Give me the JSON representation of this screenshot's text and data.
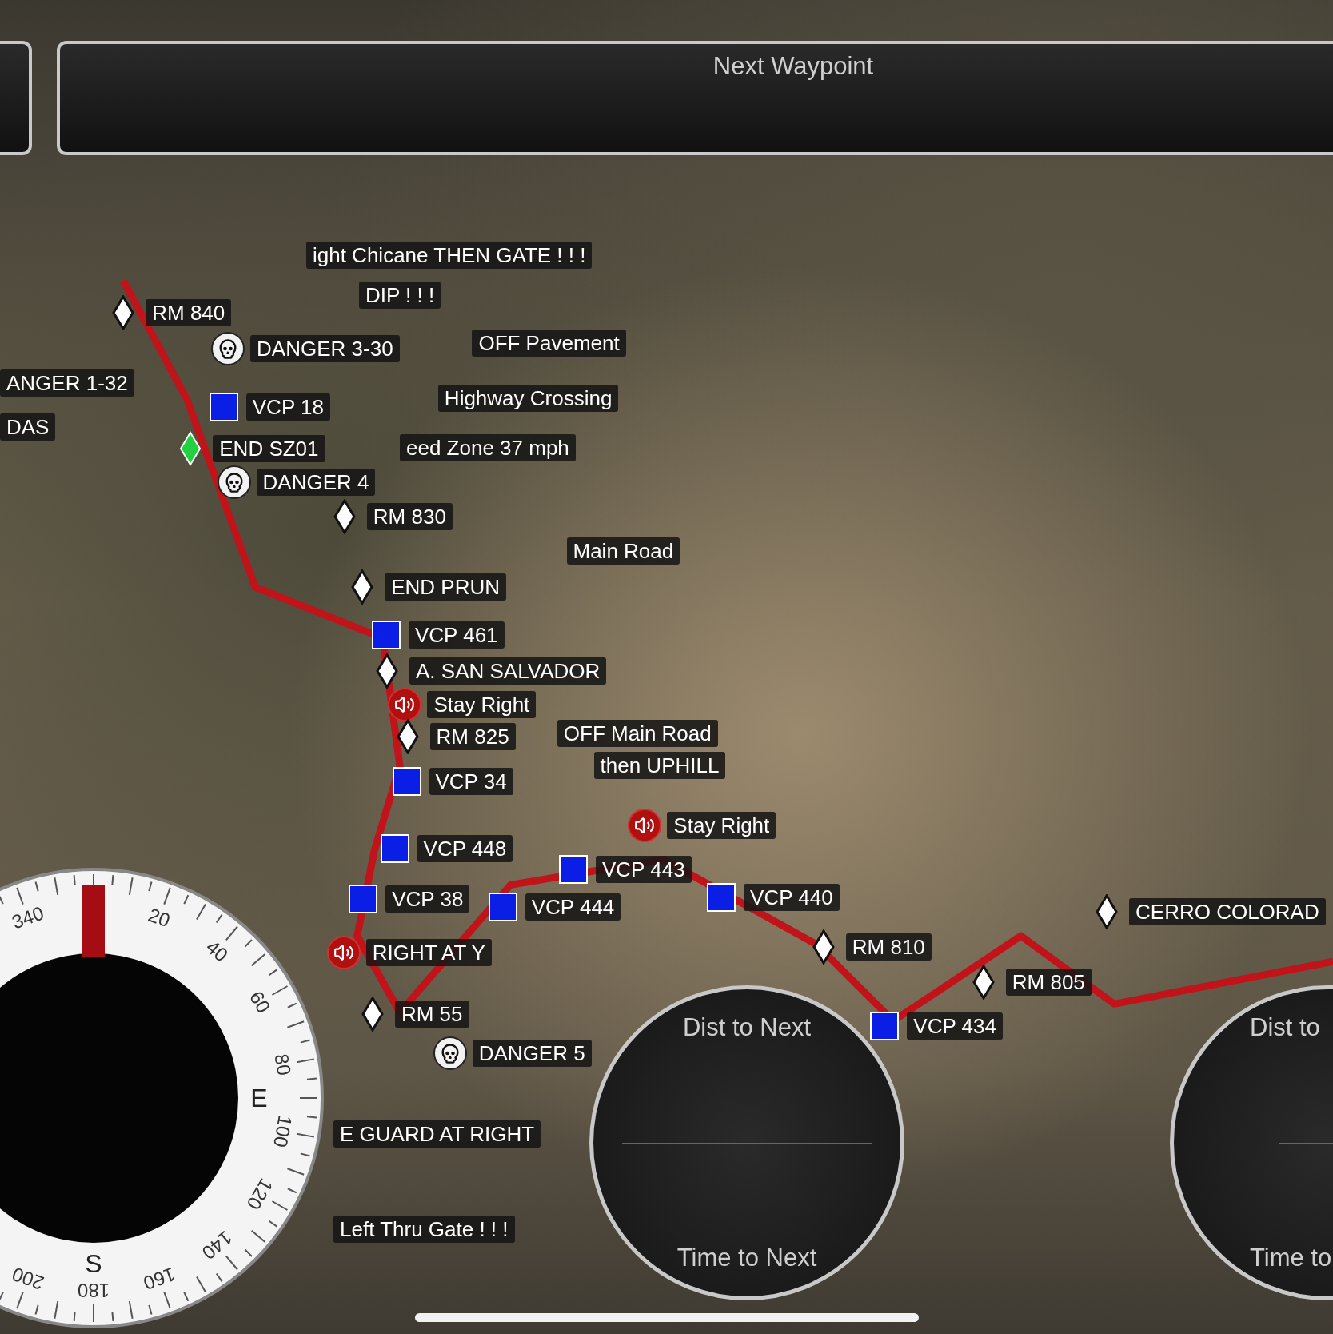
{
  "header": {
    "title": "Next Waypoint"
  },
  "markers": [
    {
      "kind": "note",
      "label": "ight Chicane THEN GATE ! ! !"
    },
    {
      "kind": "note",
      "label": "DIP ! ! !"
    },
    {
      "kind": "rm",
      "label": "RM 840"
    },
    {
      "kind": "danger",
      "label": "DANGER 3-30"
    },
    {
      "kind": "note",
      "label": "OFF Pavement"
    },
    {
      "kind": "note",
      "label": "ANGER 1-32"
    },
    {
      "kind": "vcp",
      "label": "VCP 18"
    },
    {
      "kind": "note",
      "label": "Highway Crossing"
    },
    {
      "kind": "note",
      "label": "DAS"
    },
    {
      "kind": "end",
      "label": "END SZ01"
    },
    {
      "kind": "note",
      "label": "eed Zone 37 mph"
    },
    {
      "kind": "danger",
      "label": "DANGER 4"
    },
    {
      "kind": "rm",
      "label": "RM 830"
    },
    {
      "kind": "note",
      "label": "Main Road"
    },
    {
      "kind": "rm",
      "label": "END PRUN"
    },
    {
      "kind": "vcp",
      "label": "VCP 461"
    },
    {
      "kind": "rm",
      "label": "A. SAN SALVADOR"
    },
    {
      "kind": "speaker",
      "label": "Stay Right"
    },
    {
      "kind": "rm",
      "label": "RM 825"
    },
    {
      "kind": "note",
      "label": "OFF Main Road"
    },
    {
      "kind": "note",
      "label": "then UPHILL"
    },
    {
      "kind": "vcp",
      "label": "VCP 34"
    },
    {
      "kind": "speaker",
      "label": "Stay Right"
    },
    {
      "kind": "vcp",
      "label": "VCP 448"
    },
    {
      "kind": "vcp",
      "label": "VCP 443"
    },
    {
      "kind": "vcp",
      "label": "VCP 38"
    },
    {
      "kind": "vcp",
      "label": "VCP 444"
    },
    {
      "kind": "vcp",
      "label": "VCP 440"
    },
    {
      "kind": "rm",
      "label": "CERRO COLORAD"
    },
    {
      "kind": "rm",
      "label": "RM 810"
    },
    {
      "kind": "speaker",
      "label": "RIGHT AT Y"
    },
    {
      "kind": "rm",
      "label": "RM 805"
    },
    {
      "kind": "rm",
      "label": "RM 55"
    },
    {
      "kind": "vcp",
      "label": "VCP 434"
    },
    {
      "kind": "danger",
      "label": "DANGER 5"
    },
    {
      "kind": "note",
      "label": "E GUARD AT RIGHT"
    },
    {
      "kind": "note",
      "label": "Left Thru Gate ! ! !"
    }
  ],
  "compass": {
    "degrees": [
      "20",
      "40",
      "60",
      "80",
      "100",
      "120",
      "140",
      "160",
      "180",
      "200",
      "340"
    ],
    "cardinals": [
      "E",
      "S"
    ]
  },
  "gauges": [
    {
      "top": "Dist to Next",
      "bottom": "Time to Next",
      "clipped": false
    },
    {
      "top": "Dist to",
      "bottom": "Time to",
      "clipped": true
    }
  ]
}
